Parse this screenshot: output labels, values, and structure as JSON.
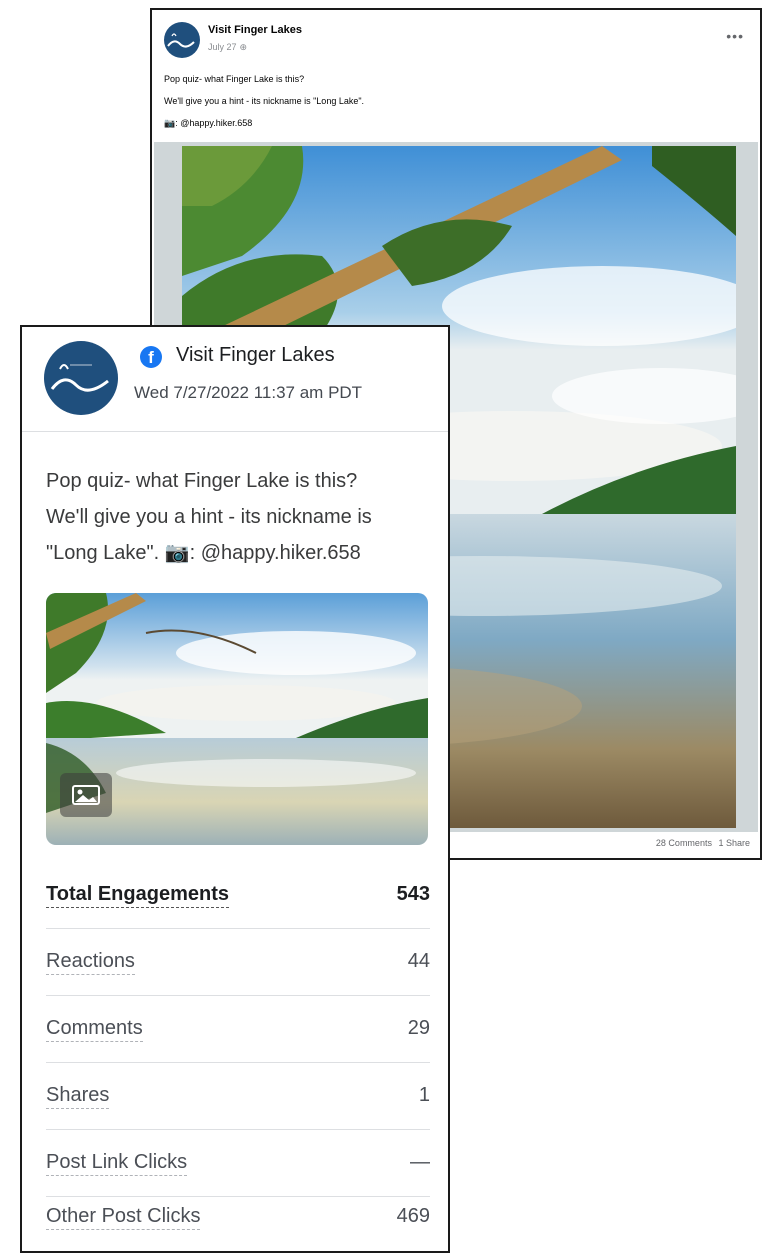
{
  "facebook_post": {
    "page_name": "Visit Finger Lakes",
    "date": "July 27",
    "privacy_icon": "globe-icon",
    "more_label": "•••",
    "text_lines": [
      "Pop quiz- what Finger Lake is this?",
      "We'll give you a hint - its nickname is \"Long Lake\".",
      "📷: @happy.hiker.658"
    ],
    "stats": {
      "comments": "28 Comments",
      "shares": "1 Share"
    }
  },
  "analytics": {
    "network_icon": "facebook-icon",
    "network_glyph": "f",
    "page_name": "Visit Finger Lakes",
    "timestamp": "Wed 7/27/2022 11:37 am PDT",
    "text_lines": [
      "Pop quiz- what Finger Lake is this?",
      "We'll give you a hint - its nickname is",
      "\"Long Lake\". 📷: @happy.hiker.658"
    ],
    "media_badge_icon": "image-icon",
    "metrics": [
      {
        "label": "Total Engagements",
        "value": "543"
      },
      {
        "label": "Reactions",
        "value": "44"
      },
      {
        "label": "Comments",
        "value": "29"
      },
      {
        "label": "Shares",
        "value": "1"
      },
      {
        "label": "Post Link Clicks",
        "value": "—"
      },
      {
        "label": "Other Post Clicks",
        "value": "469"
      }
    ]
  },
  "colors": {
    "facebook_blue": "#1877f2",
    "avatar_navy": "#1f4f7d",
    "lake_green": "#2f6a2c",
    "sky_blue": "#5b9fd8"
  }
}
